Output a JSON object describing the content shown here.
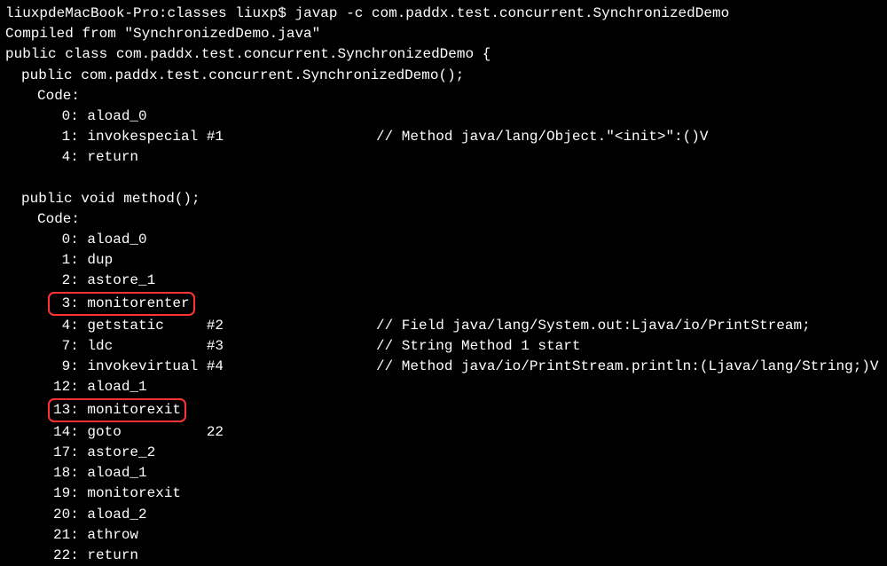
{
  "prompt": {
    "host": "liuxpdeMacBook-Pro",
    "dir": "classes",
    "user": "liuxp$",
    "command": "javap -c com.paddx.test.concurrent.SynchronizedDemo"
  },
  "compiled_from": "Compiled from \"SynchronizedDemo.java\"",
  "class_decl": "public class com.paddx.test.concurrent.SynchronizedDemo {",
  "ctor_sig": "public com.paddx.test.concurrent.SynchronizedDemo();",
  "code_label": "Code:",
  "ctor_instrs": [
    {
      "offset": " 0:",
      "op": "aload_0",
      "arg": "",
      "comment": ""
    },
    {
      "offset": " 1:",
      "op": "invokespecial",
      "arg": "#1",
      "comment": "// Method java/lang/Object.\"<init>\":()V"
    },
    {
      "offset": " 4:",
      "op": "return",
      "arg": "",
      "comment": ""
    }
  ],
  "method_sig": "public void method();",
  "method_instrs": [
    {
      "offset": " 0:",
      "op": "aload_0",
      "arg": "",
      "comment": "",
      "hl": false
    },
    {
      "offset": " 1:",
      "op": "dup",
      "arg": "",
      "comment": "",
      "hl": false
    },
    {
      "offset": " 2:",
      "op": "astore_1",
      "arg": "",
      "comment": "",
      "hl": false
    },
    {
      "offset": " 3:",
      "op": "monitorenter",
      "arg": "",
      "comment": "",
      "hl": true
    },
    {
      "offset": " 4:",
      "op": "getstatic",
      "arg": "#2",
      "comment": "// Field java/lang/System.out:Ljava/io/PrintStream;",
      "hl": false
    },
    {
      "offset": " 7:",
      "op": "ldc",
      "arg": "#3",
      "comment": "// String Method 1 start",
      "hl": false
    },
    {
      "offset": " 9:",
      "op": "invokevirtual",
      "arg": "#4",
      "comment": "// Method java/io/PrintStream.println:(Ljava/lang/String;)V",
      "hl": false
    },
    {
      "offset": "12:",
      "op": "aload_1",
      "arg": "",
      "comment": "",
      "hl": false
    },
    {
      "offset": "13:",
      "op": "monitorexit",
      "arg": "",
      "comment": "",
      "hl": true
    },
    {
      "offset": "14:",
      "op": "goto",
      "arg": "22",
      "comment": "",
      "hl": false
    },
    {
      "offset": "17:",
      "op": "astore_2",
      "arg": "",
      "comment": "",
      "hl": false
    },
    {
      "offset": "18:",
      "op": "aload_1",
      "arg": "",
      "comment": "",
      "hl": false
    },
    {
      "offset": "19:",
      "op": "monitorexit",
      "arg": "",
      "comment": "",
      "hl": false
    },
    {
      "offset": "20:",
      "op": "aload_2",
      "arg": "",
      "comment": "",
      "hl": false
    },
    {
      "offset": "21:",
      "op": "athrow",
      "arg": "",
      "comment": "",
      "hl": false
    },
    {
      "offset": "22:",
      "op": "return",
      "arg": "",
      "comment": "",
      "hl": false
    }
  ]
}
